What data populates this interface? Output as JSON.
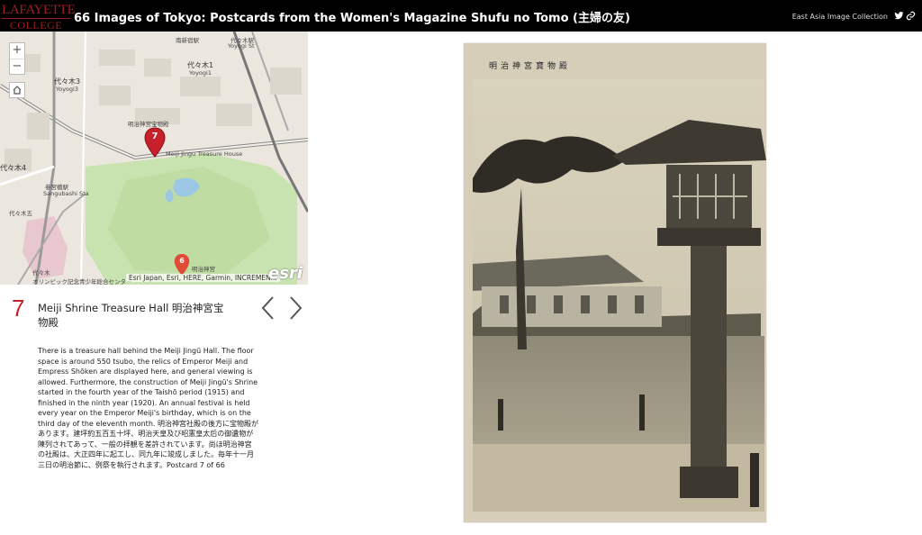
{
  "header": {
    "logo_line1": "LAFAYETTE",
    "logo_line2": "COLLEGE",
    "title": "66 Images of Tokyo: Postcards from the Women's Magazine Shufu no Tomo (主婦の友)",
    "collection_link": "East Asia Image Collection",
    "icons": [
      "twitter-icon",
      "link-icon"
    ]
  },
  "map": {
    "zoom_in": "+",
    "zoom_out": "−",
    "labels": {
      "shinsando": "南新宿駅",
      "yoyogi_st": "代々木駅",
      "yoyogi_en": "Yoyogi St",
      "yoyogi1": "代々木1",
      "yoyogi1_en": "Yoyogi1",
      "yoyogi3": "代々木3",
      "yoyogi3_en": "Yoyogi3",
      "sangubashi": "参宮橋駅",
      "sangubashi_en": "Sangubashi Sta",
      "yoyogi4": "代々木4",
      "shrine": "明治神宮",
      "yoyogi5": "代々木五",
      "yoyogi_bottom": "代々木",
      "olympic": "オリンピック記念青少年総合センター",
      "treasure": "明治神宮宝物殿",
      "treasure_en": "Meiji Jingu Treasure House"
    },
    "markers": [
      "7",
      "6"
    ],
    "attribution": "Esri Japan, Esri, HERE, Garmin, INCREMEN...",
    "brand": "esri"
  },
  "item": {
    "number": "7",
    "name": "Meiji Shrine Treasure Hall 明治神宮宝物殿",
    "description": "There is a treasure hall behind the Meiji Jingū Hall. The floor space is around 550 tsubo, the relics of Emperor Meiji and Empress Shōken are displayed here, and general viewing is allowed. Furthermore, the construction of Meiji Jingū's Shrine started in the fourth year of the Taishō period (1915) and finished in the ninth year (1920). An annual festival is held every year on the Emperor Meiji's birthday, which is on the third day of the eleventh month. 明治神宮社殿の後方に宝物殿があります。建坪約五百五十坪、明治天皇及び昭憲皇太后の御遺物が陳列されてあって、一般の拝観を差許されています。尚ほ明治神宮の社殿は、大正四年に起工し、同九年に竣成しました。毎年十一月三日の明治節に、例祭を執行されます。Postcard 7 of 66"
  },
  "postcard": {
    "caption": "明治神宮寶物殿"
  },
  "colors": {
    "accent_red": "#c8202a",
    "header_bg": "#000000",
    "logo_red": "#9c1f24"
  }
}
